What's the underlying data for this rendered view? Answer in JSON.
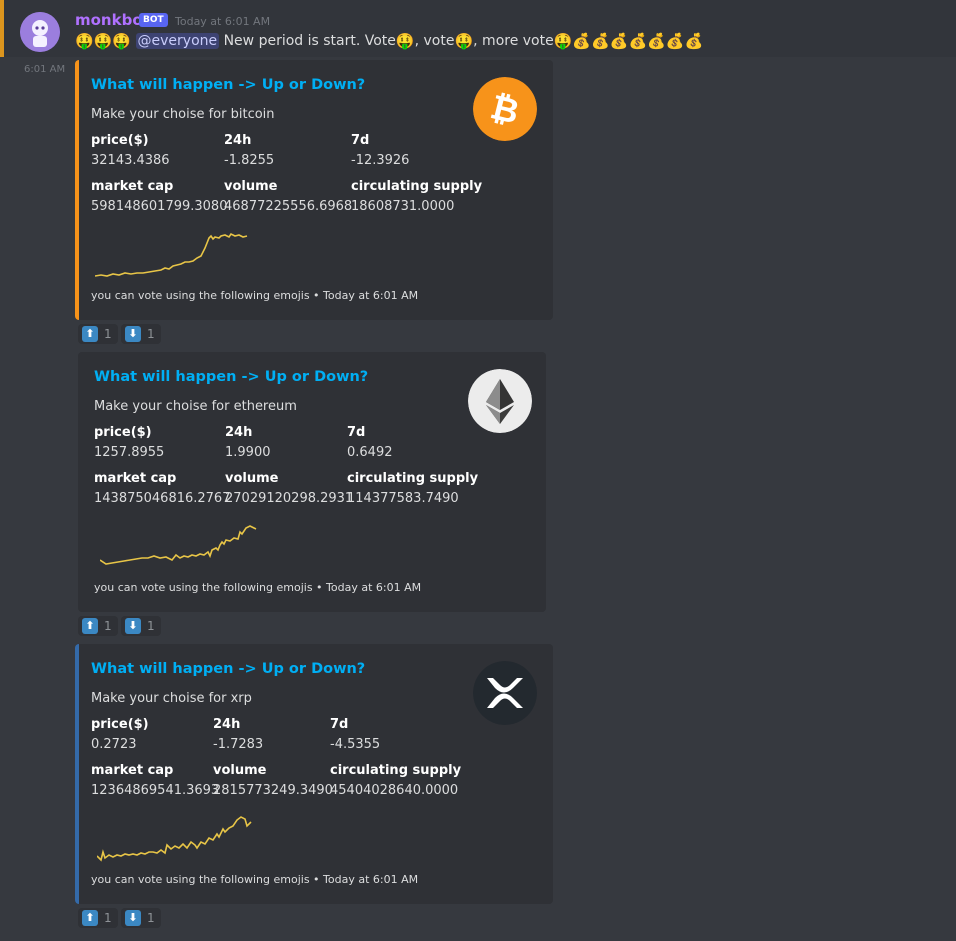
{
  "message": {
    "username": "monkbot",
    "bot_tag": "BOT",
    "timestamp": "Today at 6:01 AM",
    "side_time": "6:01 AM",
    "mention": "@everyone",
    "text_1": "New period is start. Vote",
    "text_2": ", vote",
    "text_3": ", more vote",
    "emoji_money_face": "🤑",
    "emoji_money_bag": "💰"
  },
  "embeds": [
    {
      "coin": "bitcoin",
      "title": "What will happen -> Up or Down?",
      "description": "Make your choise for bitcoin",
      "fields": [
        {
          "name": "price($)",
          "value": "32143.4386"
        },
        {
          "name": "24h",
          "value": "-1.8255"
        },
        {
          "name": "7d",
          "value": "-12.3926"
        },
        {
          "name": "market cap",
          "value": "598148601799.3080"
        },
        {
          "name": "volume",
          "value": "46877225556.6968"
        },
        {
          "name": "circulating supply",
          "value": "18608731.0000"
        }
      ],
      "footer": "you can vote using the following emojis • Today at 6:01 AM",
      "accent": "#f7931a",
      "reactions": [
        {
          "icon": "arrow-up-icon",
          "glyph": "⬆",
          "count": "1"
        },
        {
          "icon": "arrow-down-icon",
          "glyph": "⬇",
          "count": "1"
        }
      ]
    },
    {
      "coin": "ethereum",
      "title": "What will happen -> Up or Down?",
      "description": "Make your choise for ethereum",
      "fields": [
        {
          "name": "price($)",
          "value": "1257.8955"
        },
        {
          "name": "24h",
          "value": "1.9900"
        },
        {
          "name": "7d",
          "value": "0.6492"
        },
        {
          "name": "market cap",
          "value": "143875046816.2767"
        },
        {
          "name": "volume",
          "value": "27029120298.2931"
        },
        {
          "name": "circulating supply",
          "value": "114377583.7490"
        }
      ],
      "footer": "you can vote using the following emojis • Today at 6:01 AM",
      "accent": "#2f3136",
      "reactions": [
        {
          "icon": "arrow-up-icon",
          "glyph": "⬆",
          "count": "1"
        },
        {
          "icon": "arrow-down-icon",
          "glyph": "⬇",
          "count": "1"
        }
      ]
    },
    {
      "coin": "xrp",
      "title": "What will happen -> Up or Down?",
      "description": "Make your choise for xrp",
      "fields": [
        {
          "name": "price($)",
          "value": "0.2723"
        },
        {
          "name": "24h",
          "value": "-1.7283"
        },
        {
          "name": "7d",
          "value": "-4.5355"
        },
        {
          "name": "market cap",
          "value": "12364869541.3693"
        },
        {
          "name": "volume",
          "value": "2815773249.3490"
        },
        {
          "name": "circulating supply",
          "value": "45404028640.0000"
        }
      ],
      "footer": "you can vote using the following emojis • Today at 6:01 AM",
      "accent": "#346aa9",
      "reactions": [
        {
          "icon": "arrow-up-icon",
          "glyph": "⬆",
          "count": "1"
        },
        {
          "icon": "arrow-down-icon",
          "glyph": "⬇",
          "count": "1"
        }
      ]
    }
  ],
  "colors": {
    "background": "#36393f",
    "embed_bg": "#2f3136",
    "title": "#00aff4",
    "username": "#b071ff",
    "sparkline": "#e8c547"
  }
}
